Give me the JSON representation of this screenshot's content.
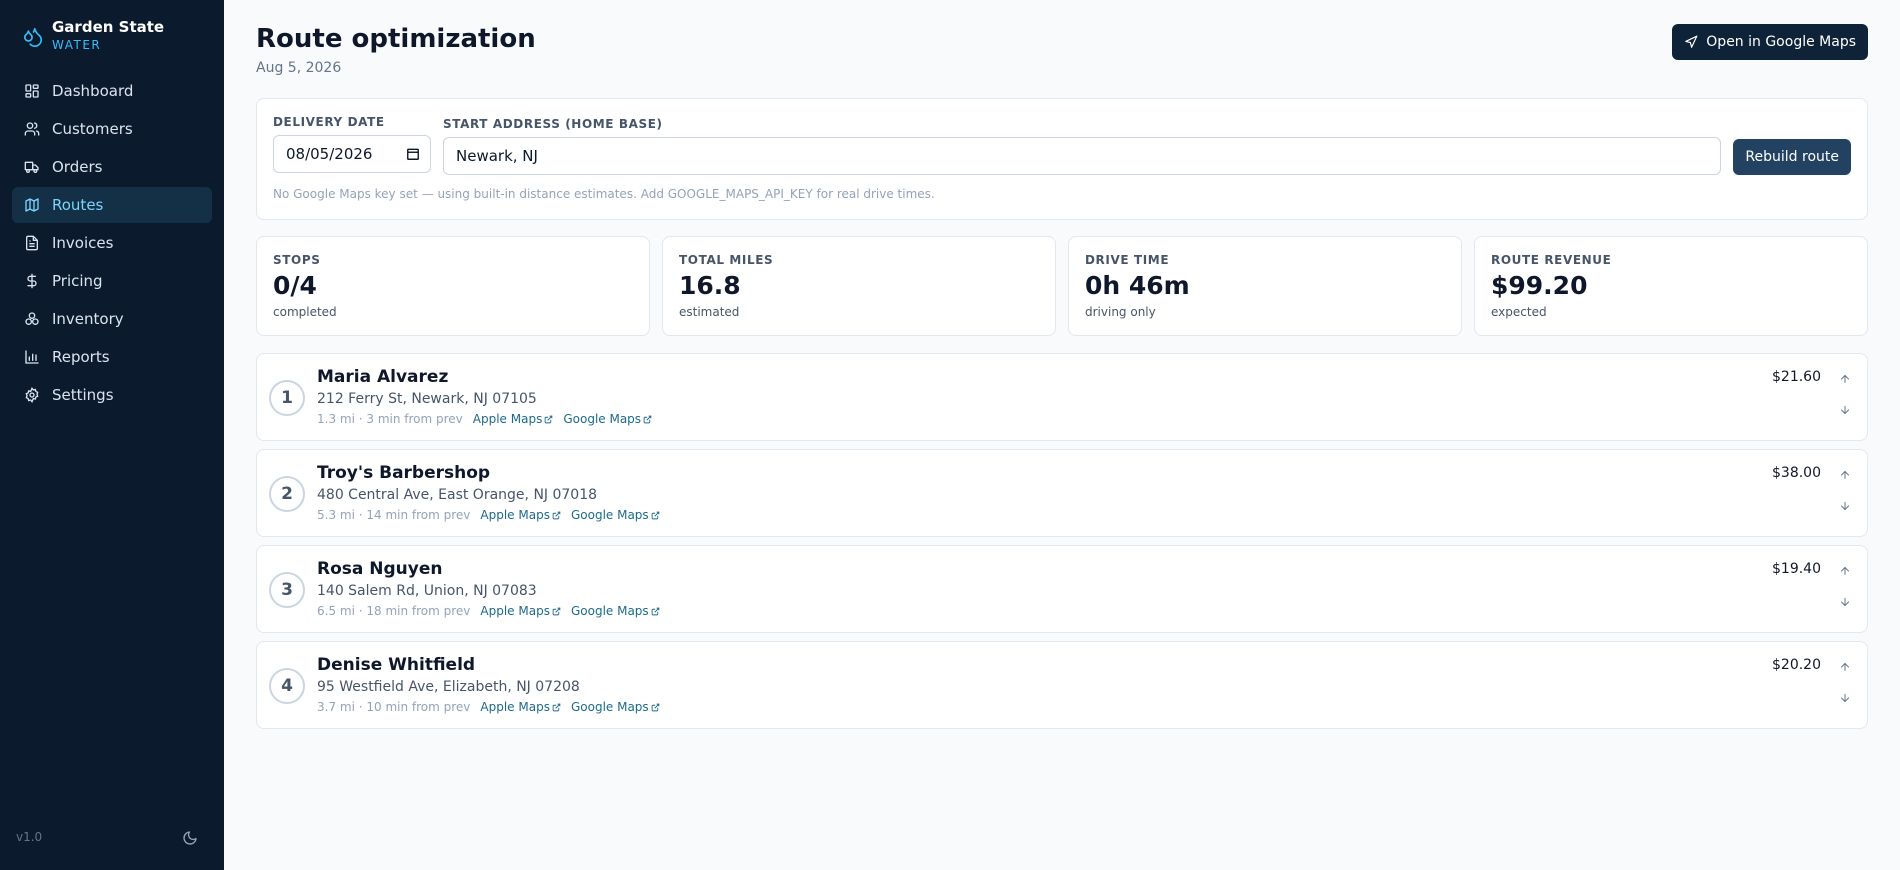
{
  "brand": {
    "name": "Garden State",
    "sub": "WATER"
  },
  "nav": [
    {
      "label": "Dashboard",
      "icon": "dashboard-icon"
    },
    {
      "label": "Customers",
      "icon": "users-icon"
    },
    {
      "label": "Orders",
      "icon": "truck-icon"
    },
    {
      "label": "Routes",
      "icon": "map-icon",
      "active": true
    },
    {
      "label": "Invoices",
      "icon": "invoice-icon"
    },
    {
      "label": "Pricing",
      "icon": "dollar-icon"
    },
    {
      "label": "Inventory",
      "icon": "inventory-icon"
    },
    {
      "label": "Reports",
      "icon": "chart-icon"
    },
    {
      "label": "Settings",
      "icon": "gear-icon"
    }
  ],
  "version": "v1.0",
  "page": {
    "title": "Route optimization",
    "date": "Aug 5, 2026"
  },
  "actions": {
    "open_maps": "Open in Google Maps",
    "rebuild": "Rebuild route"
  },
  "form": {
    "date_label": "DELIVERY DATE",
    "date_value": "08/05/2026",
    "address_label": "START ADDRESS (HOME BASE)",
    "address_value": "Newark, NJ",
    "hint": "No Google Maps key set — using built-in distance estimates. Add GOOGLE_MAPS_API_KEY for real drive times."
  },
  "stats": [
    {
      "label": "STOPS",
      "value": "0/4",
      "sub": "completed"
    },
    {
      "label": "TOTAL MILES",
      "value": "16.8",
      "sub": "estimated"
    },
    {
      "label": "DRIVE TIME",
      "value": "0h 46m",
      "sub": "driving only"
    },
    {
      "label": "ROUTE REVENUE",
      "value": "$99.20",
      "sub": "expected"
    }
  ],
  "links": {
    "apple": "Apple Maps",
    "google": "Google Maps"
  },
  "stops": [
    {
      "num": "1",
      "name": "Maria Alvarez",
      "address": "212 Ferry St, Newark, NJ 07105",
      "meta": "1.3 mi · 3 min from prev",
      "amount": "$21.60"
    },
    {
      "num": "2",
      "name": "Troy's Barbershop",
      "address": "480 Central Ave, East Orange, NJ 07018",
      "meta": "5.3 mi · 14 min from prev",
      "amount": "$38.00"
    },
    {
      "num": "3",
      "name": "Rosa Nguyen",
      "address": "140 Salem Rd, Union, NJ 07083",
      "meta": "6.5 mi · 18 min from prev",
      "amount": "$19.40"
    },
    {
      "num": "4",
      "name": "Denise Whitfield",
      "address": "95 Westfield Ave, Elizabeth, NJ 07208",
      "meta": "3.7 mi · 10 min from prev",
      "amount": "$20.20"
    }
  ],
  "colors": {
    "sidebar_bg": "#0c1a2e",
    "accent": "#38bdf8",
    "primary_button": "#0f2338",
    "link": "#1d6a8c"
  }
}
